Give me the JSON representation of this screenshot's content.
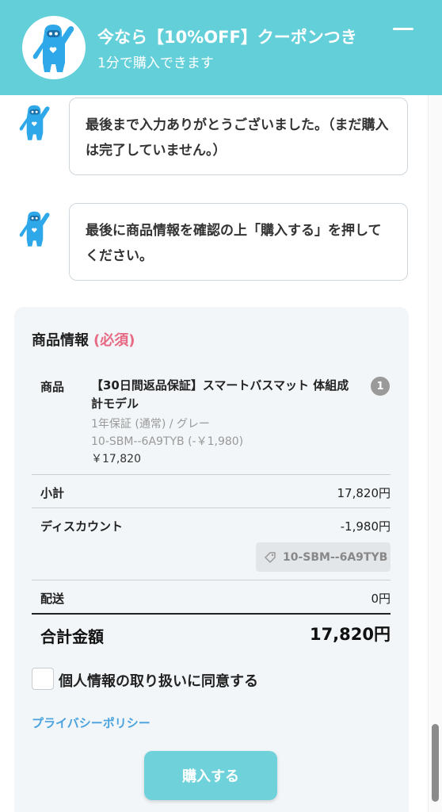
{
  "header": {
    "title": "今なら【10%OFF】クーポンつき",
    "subtitle": "1分で購入できます",
    "mascot_icon": "mascot-icon",
    "minimize_icon": "minimize-icon"
  },
  "messages": [
    {
      "text": "最後まで入力ありがとうございました。（まだ購入は完了していません。）"
    },
    {
      "text": "最後に商品情報を確認の上「購入する」を押してください。"
    }
  ],
  "product_info": {
    "title": "商品情報",
    "required": "(必須)",
    "item_label": "商品",
    "item_name": "【30日間返品保証】スマートバスマット 体組成計モデル",
    "variant": "1年保証 (通常) / グレー",
    "coupon_line": "10-SBM--6A9TYB (-￥1,980)",
    "price": "￥17,820",
    "quantity": "1",
    "subtotal_label": "小計",
    "subtotal_value": "17,820円",
    "discount_label": "ディスカウント",
    "discount_value": "-1,980円",
    "coupon_code": "10-SBM--6A9TYB",
    "shipping_label": "配送",
    "shipping_value": "0円",
    "total_label": "合計金額",
    "total_value": "17,820円"
  },
  "consent": {
    "label": "個人情報の取り扱いに同意する",
    "checked": false
  },
  "privacy_link": "プライバシーポリシー",
  "buy_button": "購入する",
  "colors": {
    "brand": "#63cfd9",
    "button": "#6fd2da",
    "required": "#e76a84",
    "link": "#4aa3df",
    "card_bg": "#f2f6f8"
  }
}
